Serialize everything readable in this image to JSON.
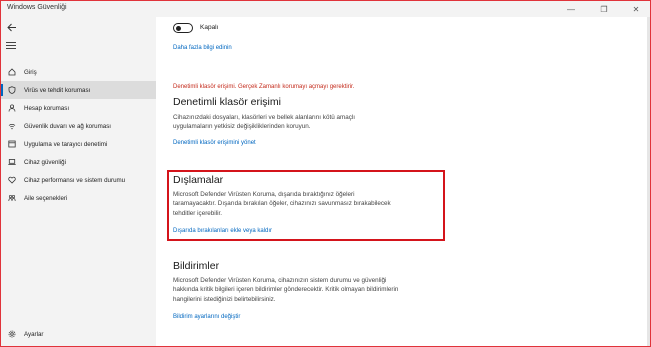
{
  "window": {
    "title": "Windows Güvenliği",
    "minimize_glyph": "—",
    "restore_glyph": "❐",
    "close_glyph": "✕"
  },
  "sidebar": {
    "items": [
      {
        "label": "Giriş",
        "icon": "home-icon"
      },
      {
        "label": "Virüs ve tehdit koruması",
        "icon": "shield-icon",
        "active": true
      },
      {
        "label": "Hesap koruması",
        "icon": "person-icon"
      },
      {
        "label": "Güvenlik duvarı ve ağ koruması",
        "icon": "wifi-icon"
      },
      {
        "label": "Uygulama ve tarayıcı denetimi",
        "icon": "app-browser-icon"
      },
      {
        "label": "Cihaz güvenliği",
        "icon": "laptop-icon"
      },
      {
        "label": "Cihaz performansı ve sistem durumu",
        "icon": "heart-icon"
      },
      {
        "label": "Aile seçenekleri",
        "icon": "family-icon"
      }
    ],
    "settings_label": "Ayarlar"
  },
  "main": {
    "toggle_state_label": "Kapalı",
    "toggle_on": false,
    "more_info_link": "Daha fazla bilgi edinin",
    "warning_text": "Denetimli klasör erişimi. Gerçek Zamanlı korumayı açmayı gerektirir.",
    "cfa": {
      "heading": "Denetimli klasör erişimi",
      "description": "Cihazınızdaki dosyaları, klasörleri ve bellek alanlarını kötü amaçlı uygulamaların yetkisiz değişikliklerinden koruyun.",
      "link": "Denetimli klasör erişimini yönet"
    },
    "exclusions": {
      "heading": "Dışlamalar",
      "description": "Microsoft Defender Virüsten Koruma, dışarıda bıraktığınız öğeleri taramayacaktır.  Dışarıda bırakılan öğeler, cihazınızı savunmasız bırakabilecek tehditler içerebilir.",
      "link": "Dışarıda bırakılanları ekle veya kaldır"
    },
    "notifications": {
      "heading": "Bildirimler",
      "description": "Microsoft Defender Virüsten Koruma, cihazınızın sistem durumu ve güvenliği hakkında kritik bilgileri içeren bildirimler gönderecektir. Kritik olmayan bildirimlerin hangilerini istediğinizi belirtebilirsiniz.",
      "link": "Bildirim ayarlarını değiştir"
    }
  },
  "colors": {
    "accent": "#0067c0",
    "warning": "#c42b1c",
    "highlight": "#d4141b"
  }
}
